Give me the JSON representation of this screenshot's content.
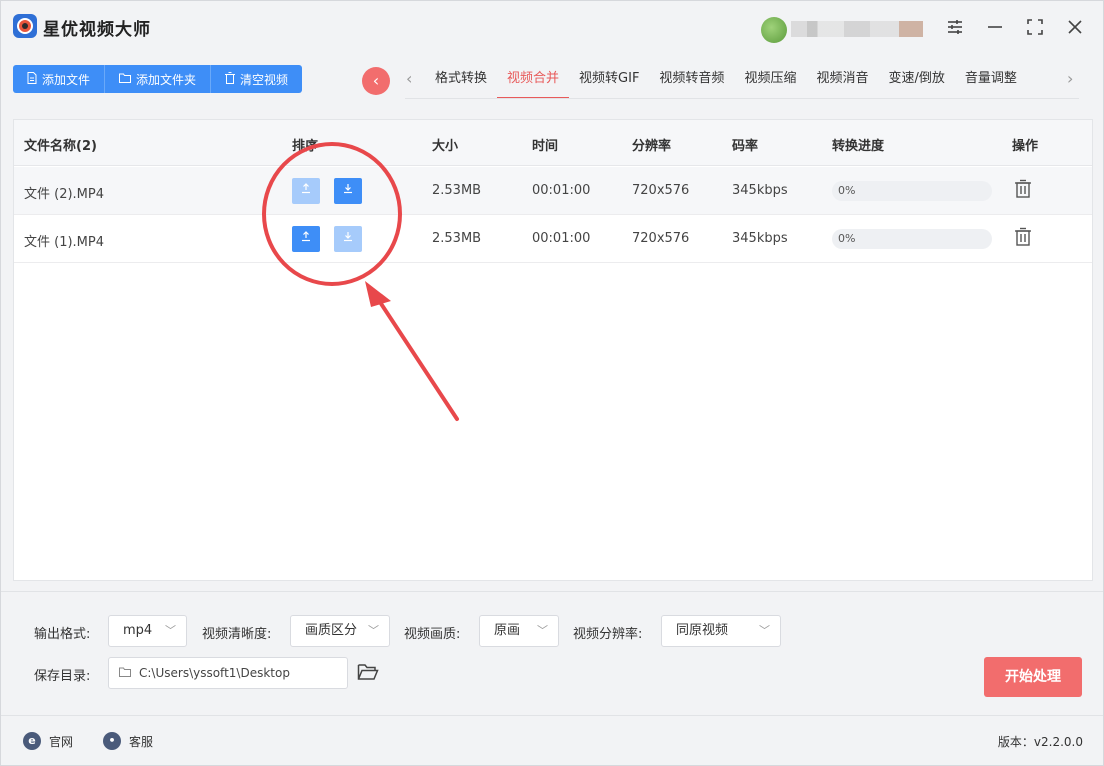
{
  "app": {
    "title": "星优视频大师"
  },
  "toolbar": {
    "add_file": "添加文件",
    "add_folder": "添加文件夹",
    "clear": "清空视频"
  },
  "tabs": [
    {
      "label": "格式转换",
      "active": false
    },
    {
      "label": "视频合并",
      "active": true
    },
    {
      "label": "视频转GIF",
      "active": false
    },
    {
      "label": "视频转音频",
      "active": false
    },
    {
      "label": "视频压缩",
      "active": false
    },
    {
      "label": "视频消音",
      "active": false
    },
    {
      "label": "变速/倒放",
      "active": false
    },
    {
      "label": "音量调整",
      "active": false
    }
  ],
  "table": {
    "headers": {
      "name": "文件名称(2)",
      "sort": "排序",
      "size": "大小",
      "time": "时间",
      "resolution": "分辨率",
      "bitrate": "码率",
      "progress": "转换进度",
      "action": "操作"
    },
    "rows": [
      {
        "name": "文件 (2).MP4",
        "size": "2.53MB",
        "time": "00:01:00",
        "resolution": "720x576",
        "bitrate": "345kbps",
        "progress": "0%",
        "progress_value": 0
      },
      {
        "name": "文件 (1).MP4",
        "size": "2.53MB",
        "time": "00:01:00",
        "resolution": "720x576",
        "bitrate": "345kbps",
        "progress": "0%",
        "progress_value": 0
      }
    ]
  },
  "settings": {
    "output_format_label": "输出格式:",
    "output_format_value": "mp4",
    "clarity_label": "视频清晰度:",
    "clarity_value": "画质区分",
    "quality_label": "视频画质:",
    "quality_value": "原画",
    "resolution_label": "视频分辨率:",
    "resolution_value": "同原视频",
    "save_dir_label": "保存目录:",
    "save_dir_value": "C:\\Users\\yssoft1\\Desktop",
    "start_button": "开始处理"
  },
  "statusbar": {
    "website": "官网",
    "support": "客服",
    "version": "版本：v2.2.0.0"
  },
  "colors": {
    "primary_blue": "#3e8ef7",
    "accent_red": "#f26d6d",
    "annotation_red": "#e8484b"
  }
}
